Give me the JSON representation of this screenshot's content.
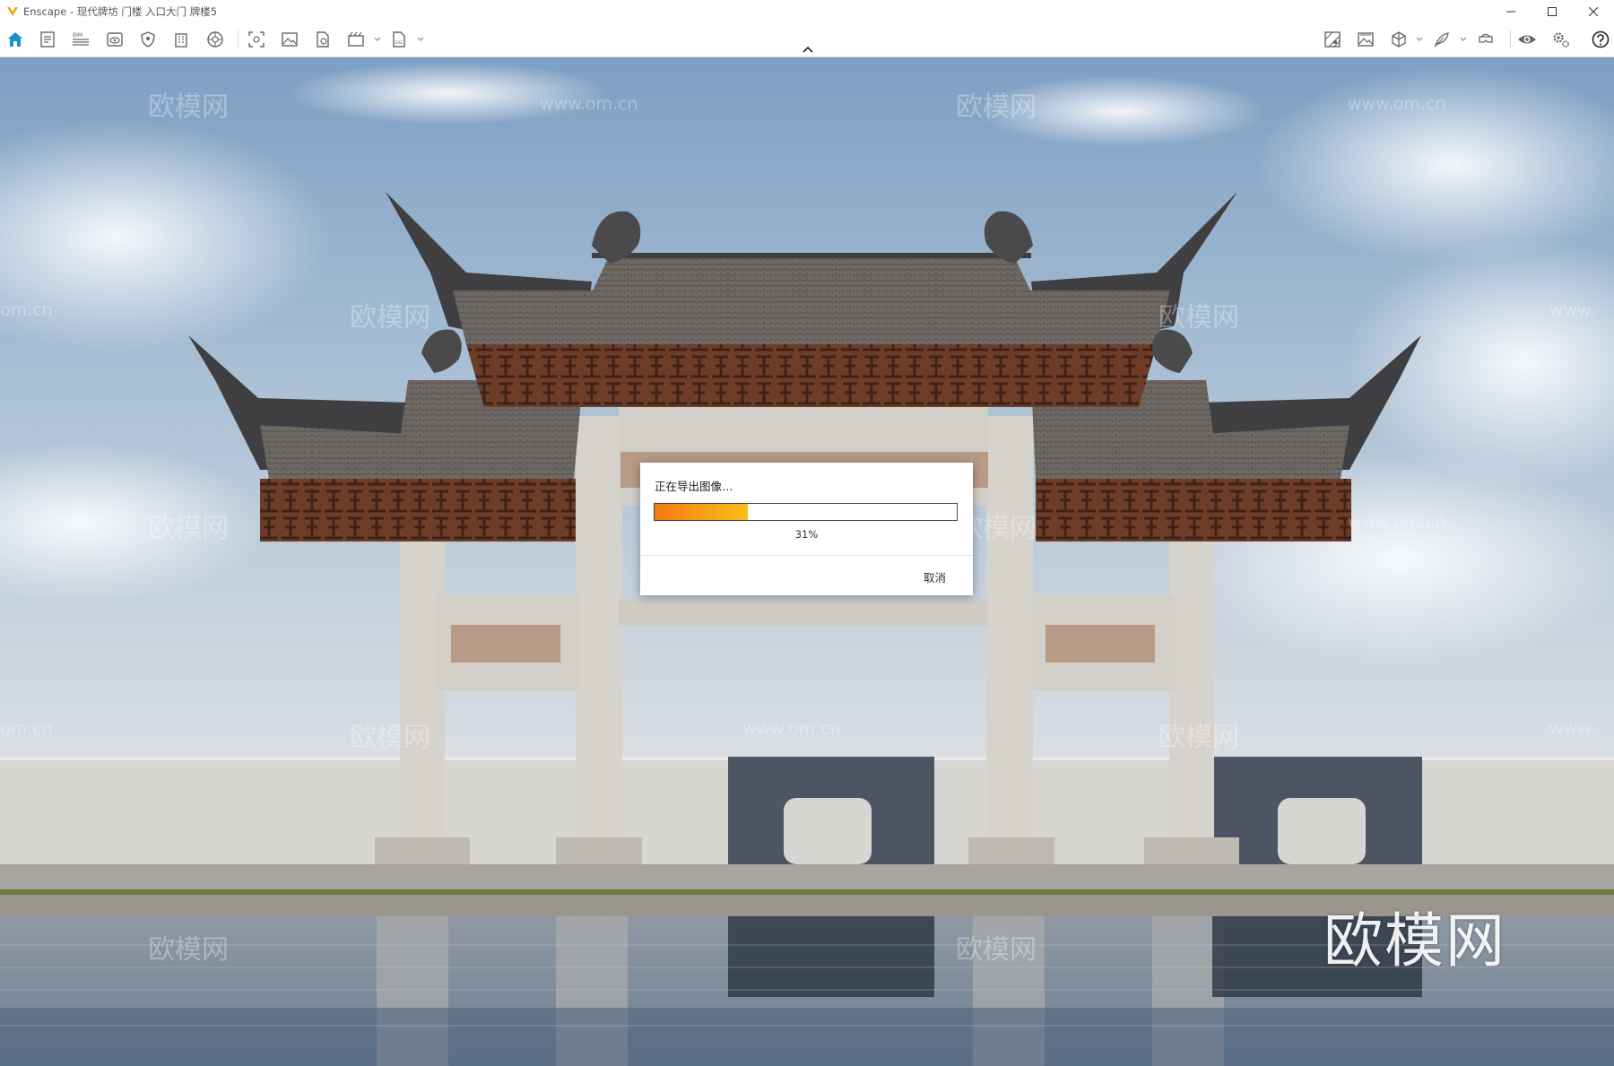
{
  "window": {
    "title": "Enscape - 现代牌坊 门楼 入口大门 牌楼5",
    "controls": [
      "minimize",
      "maximize",
      "close"
    ]
  },
  "toolbar": {
    "left_icons": [
      "home-icon",
      "document-icon",
      "bim-icon",
      "view-icon",
      "shield-icon",
      "building-icon",
      "sphere-icon",
      "screenshot-icon",
      "image-icon",
      "export-file-icon",
      "video-icon",
      "exe-export-icon"
    ],
    "right_icons": [
      "map-icon",
      "image-gallery-icon",
      "cube-icon",
      "feather-icon",
      "vr-headset-icon",
      "eye-icon",
      "settings-icon",
      "help-icon"
    ]
  },
  "dialog": {
    "title": "正在导出图像…",
    "progress": 0.31,
    "progress_label": "31%",
    "cancel_label": "取消"
  },
  "watermarks": {
    "brand": "欧模网",
    "url": "www.om.cn",
    "url_fragment": "om.cn",
    "url_prefix": "www."
  },
  "colors": {
    "progress_start": "#f47a12",
    "progress_end": "#fbbd1a",
    "home_icon": "#1a8fd6",
    "sky_top": "#7d9fc3",
    "sky_bottom": "#d9dee3"
  }
}
